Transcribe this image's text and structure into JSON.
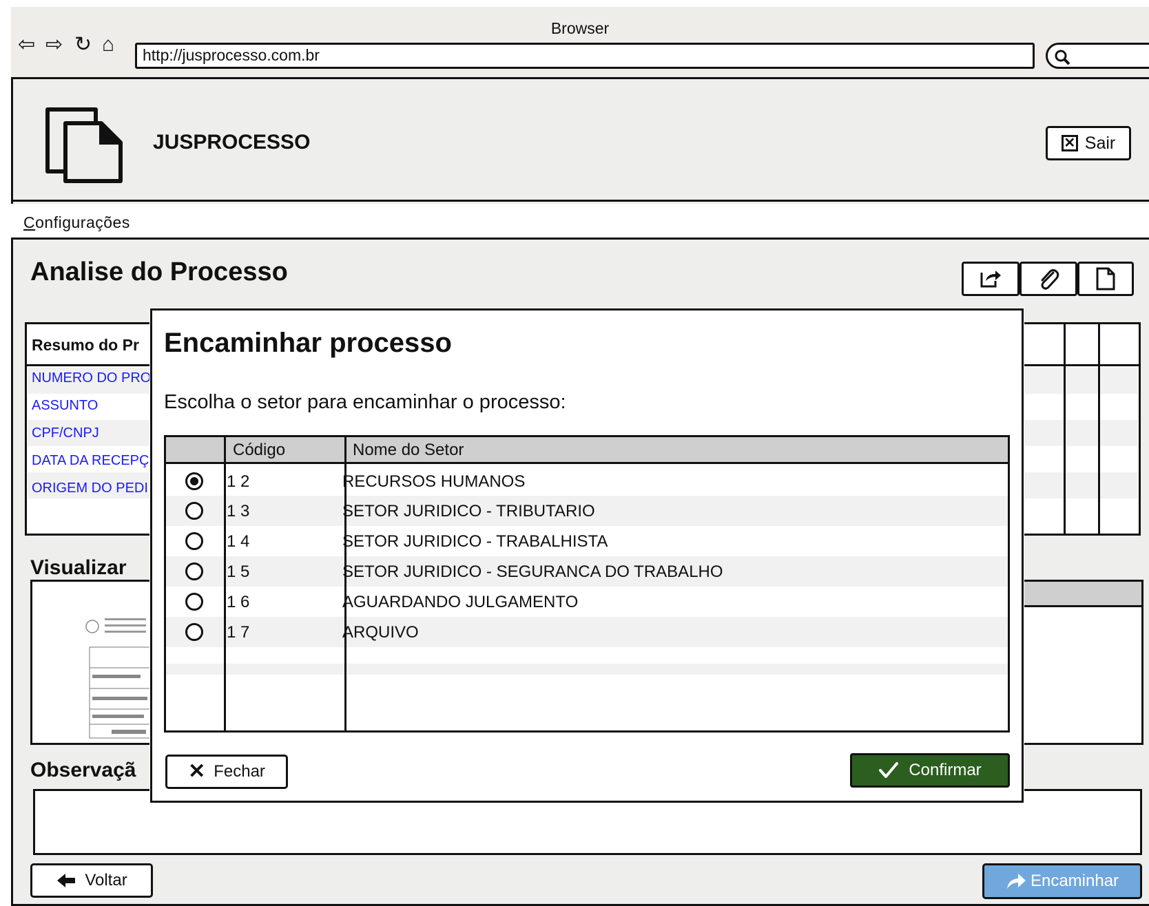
{
  "browser": {
    "title": "Browser",
    "url": "http://jusprocesso.com.br"
  },
  "header": {
    "app_name": "JUSPROCESSO",
    "logout_label": "Sair"
  },
  "menu": {
    "items": [
      {
        "label": "Configurações"
      }
    ]
  },
  "page": {
    "title": "Analise do Processo",
    "summary": {
      "title": "Resumo do Pr",
      "fields": [
        "NUMERO DO PRO",
        "ASSUNTO",
        "CPF/CNPJ",
        "DATA DA RECEPÇ",
        "ORIGEM DO PEDI"
      ]
    },
    "visualizar_label": "Visualizar",
    "observacao_label": "Observaçã",
    "back_label": "Voltar",
    "forward_label": "Encaminhar"
  },
  "modal": {
    "title": "Encaminhar processo",
    "instruction": "Escolha o setor para encaminhar o processo:",
    "columns": [
      "Código",
      "Nome do Setor"
    ],
    "rows": [
      {
        "code": "1 2",
        "name": "RECURSOS HUMANOS",
        "selected": true
      },
      {
        "code": "1 3",
        "name": "SETOR JURIDICO - TRIBUTARIO",
        "selected": false
      },
      {
        "code": "1 4",
        "name": "SETOR JURIDICO - TRABALHISTA",
        "selected": false
      },
      {
        "code": "1 5",
        "name": "SETOR JURIDICO - SEGURANCA DO TRABALHO",
        "selected": false
      },
      {
        "code": "1 6",
        "name": "AGUARDANDO JULGAMENTO",
        "selected": false
      },
      {
        "code": "1 7",
        "name": "ARQUIVO",
        "selected": false
      }
    ],
    "close_label": "Fechar",
    "confirm_label": "Confirmar"
  },
  "colors": {
    "confirm": "#2c5e20",
    "forward": "#70a8dd",
    "link": "#1a1aff"
  }
}
